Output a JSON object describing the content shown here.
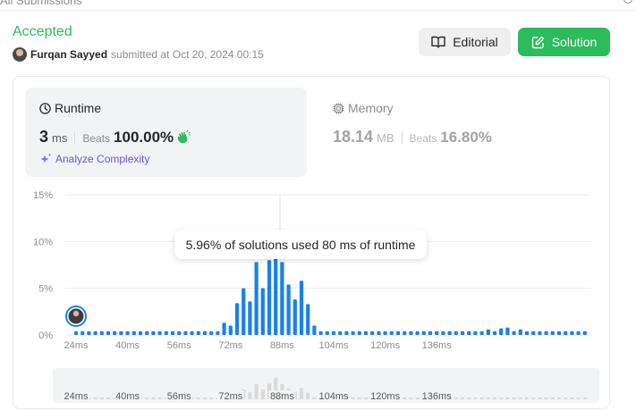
{
  "header": {
    "breadcrumb": "All Submissions"
  },
  "submission": {
    "status": "Accepted",
    "user": "Furqan Sayyed",
    "submitted_text": "submitted at Oct 20, 2024 00:15"
  },
  "buttons": {
    "editorial": "Editorial",
    "solution": "Solution"
  },
  "runtime": {
    "title": "Runtime",
    "value": "3",
    "unit": "ms",
    "beats_label": "Beats",
    "beats": "100.00%",
    "analyze": "Analyze Complexity"
  },
  "memory": {
    "title": "Memory",
    "value": "18.14",
    "unit": "MB",
    "beats_label": "Beats",
    "beats": "16.80%"
  },
  "tooltip": "5.96% of solutions used 80 ms of runtime",
  "colors": {
    "accent": "#2cbb5d",
    "bar": "#1a7ff0",
    "purple": "#6e52d7",
    "highlight": "#ffa116"
  },
  "chart_data": {
    "type": "bar",
    "ytick_labels": [
      "15%",
      "10%",
      "5%",
      "0%"
    ],
    "yticks": [
      15,
      10,
      5,
      0
    ],
    "ylim": [
      0,
      15
    ],
    "xtick_labels": [
      "24ms",
      "40ms",
      "56ms",
      "72ms",
      "88ms",
      "104ms",
      "120ms",
      "136ms"
    ],
    "x_start": 24,
    "x_step": 2,
    "values": [
      0.4,
      0.4,
      0.4,
      0.4,
      0.4,
      0.4,
      0.4,
      0.4,
      0.4,
      0.4,
      0.4,
      0.4,
      0.4,
      0.4,
      0.4,
      0.4,
      0.4,
      0.4,
      0.4,
      0.4,
      0.4,
      0.4,
      0.4,
      1.3,
      1.0,
      3.4,
      5.0,
      3.6,
      7.8,
      5.0,
      8.0,
      11.0,
      7.8,
      5.4,
      3.8,
      5.8,
      3.3,
      1.0,
      0.4,
      0.4,
      0.4,
      0.4,
      0.4,
      0.4,
      0.4,
      0.4,
      0.4,
      0.4,
      0.4,
      0.4,
      0.4,
      0.4,
      0.4,
      0.4,
      0.4,
      0.4,
      0.4,
      0.4,
      0.4,
      0.4,
      0.4,
      0.4,
      0.4,
      0.4,
      0.6,
      0.4,
      0.7,
      0.8,
      0.4,
      0.6,
      0.4,
      0.4,
      0.4,
      0.4,
      0.4,
      0.4,
      0.4,
      0.4,
      0.4,
      0.4
    ],
    "highlight_index": 0,
    "grid": true
  }
}
